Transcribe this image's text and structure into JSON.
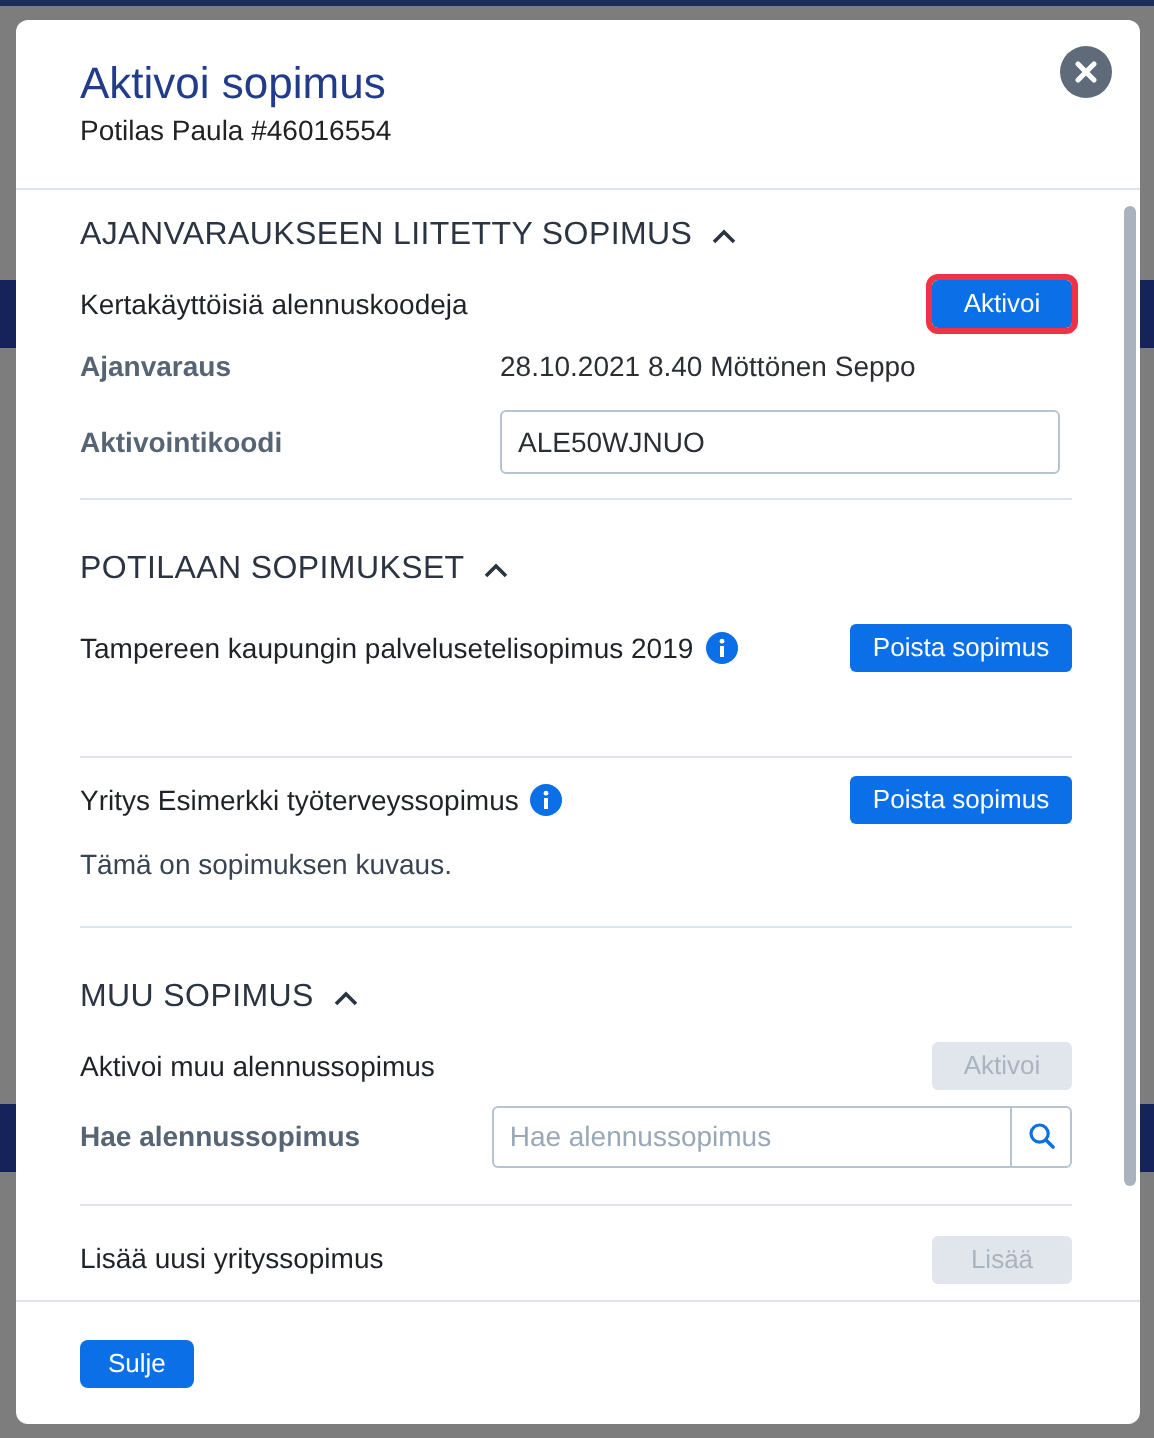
{
  "dialog": {
    "title": "Aktivoi sopimus",
    "subtitle": "Potilas Paula #46016554"
  },
  "sections": [
    {
      "title": "AJANVARAUKSEEN LIITETTY SOPIMUS",
      "expanded": true,
      "items": [
        {
          "kind": "action",
          "label": "Kertakäyttöisiä alennuskoodeja",
          "button": "Aktivoi",
          "disabled": false,
          "focused": true
        },
        {
          "kind": "field",
          "label": "Ajanvaraus",
          "value": "28.10.2021 8.40 Möttönen Seppo"
        },
        {
          "kind": "input",
          "label": "Aktivointikoodi",
          "value": "ALE50WJNUO"
        }
      ]
    },
    {
      "title": "POTILAAN SOPIMUKSET",
      "expanded": true,
      "items": [
        {
          "kind": "contract",
          "label": "Tampereen kaupungin palvelusetelisopimus 2019",
          "button": "Poista sopimus"
        },
        {
          "kind": "contract",
          "label": "Yritys Esimerkki työterveyssopimus",
          "button": "Poista sopimus",
          "description": "Tämä on sopimuksen kuvaus."
        }
      ]
    },
    {
      "title": "MUU SOPIMUS",
      "expanded": true,
      "items": [
        {
          "kind": "action",
          "label": "Aktivoi muu alennussopimus",
          "button": "Aktivoi",
          "disabled": true,
          "focused": false
        },
        {
          "kind": "search",
          "label": "Hae alennussopimus",
          "placeholder": "Hae alennussopimus"
        },
        {
          "kind": "action",
          "label": "Lisää uusi yrityssopimus",
          "button": "Lisää",
          "disabled": true,
          "focused": false
        }
      ]
    }
  ],
  "footer_button": "Sulje"
}
